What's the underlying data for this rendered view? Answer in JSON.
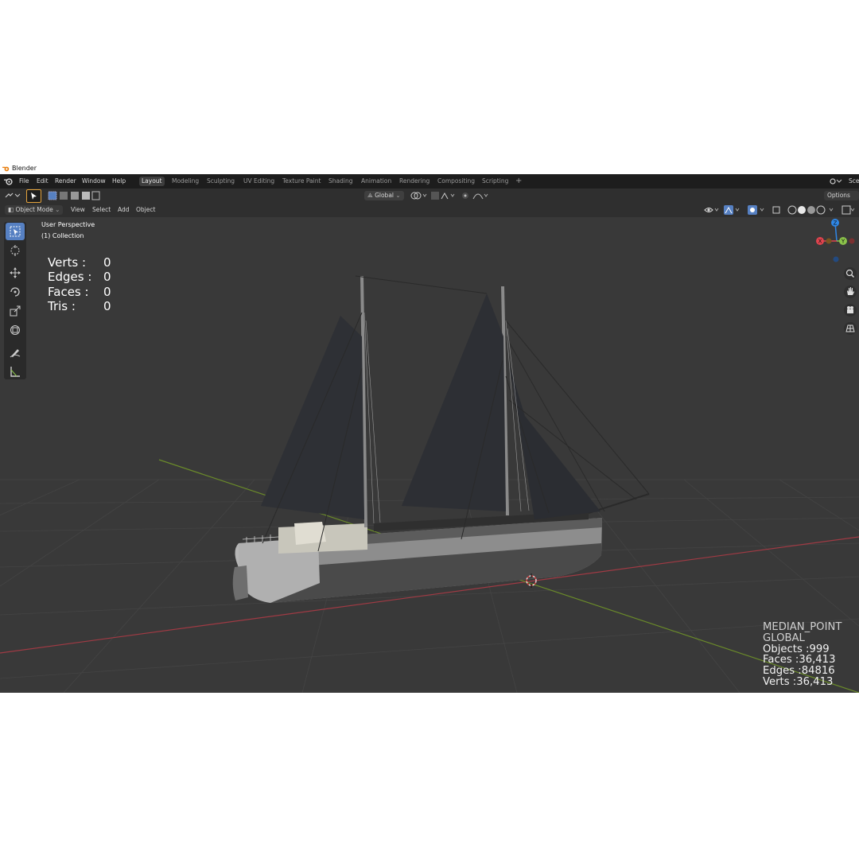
{
  "window": {
    "title": "Blender"
  },
  "menu": [
    "File",
    "Edit",
    "Render",
    "Window",
    "Help"
  ],
  "workspaces": [
    {
      "label": "Layout",
      "active": true
    },
    {
      "label": "Modeling",
      "active": false
    },
    {
      "label": "Sculpting",
      "active": false
    },
    {
      "label": "UV Editing",
      "active": false
    },
    {
      "label": "Texture Paint",
      "active": false
    },
    {
      "label": "Shading",
      "active": false
    },
    {
      "label": "Animation",
      "active": false
    },
    {
      "label": "Rendering",
      "active": false
    },
    {
      "label": "Compositing",
      "active": false
    },
    {
      "label": "Scripting",
      "active": false
    }
  ],
  "add_workspace_label": "+",
  "scene_label": "Sce",
  "toolbar": {
    "transform_orientation": "Global",
    "options_label": "Options"
  },
  "header": {
    "mode": "Object Mode",
    "menus": [
      "View",
      "Select",
      "Add",
      "Object"
    ]
  },
  "viewport": {
    "perspective_label": "User Perspective",
    "collection_label": "(1) Collection",
    "mesh_stats": [
      {
        "label": "Verts :",
        "value": "0"
      },
      {
        "label": "Edges :",
        "value": "0"
      },
      {
        "label": "Faces :",
        "value": "0"
      },
      {
        "label": "Tris :",
        "value": "0"
      }
    ],
    "scene_stats": {
      "pivot": "MEDIAN_POINT",
      "orientation": "GLOBAL",
      "objects": "Objects :999",
      "faces": "Faces :36,413",
      "edges": "Edges :84816",
      "verts": "Verts :36,413"
    },
    "gizmo_axes": {
      "x": "X",
      "y": "Y",
      "z": "Z"
    }
  },
  "colors": {
    "active_tool": "#5680c2",
    "axis_x": "#e0444e",
    "axis_y": "#8bc34a",
    "axis_z": "#2f87e6",
    "viewport_bg": "#393939"
  },
  "icons": [
    "blender-logo-icon",
    "select-box-icon",
    "cursor-icon",
    "move-icon",
    "rotate-icon",
    "scale-icon",
    "transform-icon",
    "annotate-icon",
    "measure-icon",
    "zoom-icon",
    "hand-pan-icon",
    "camera-icon",
    "grid-icon"
  ]
}
